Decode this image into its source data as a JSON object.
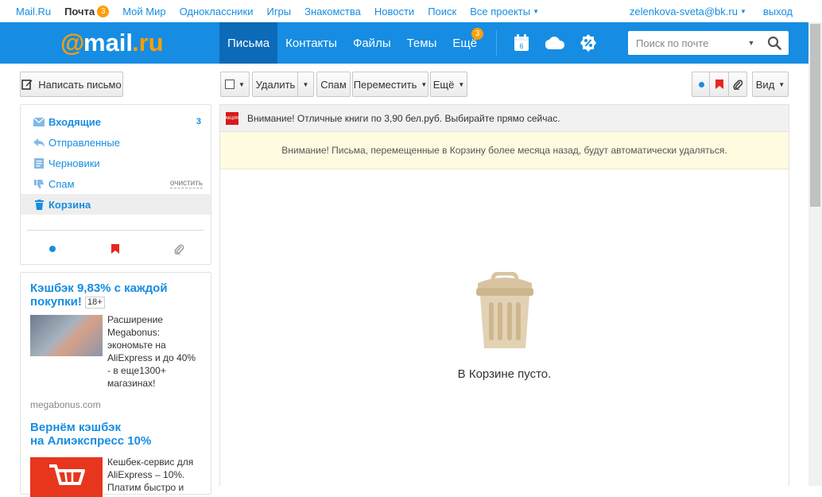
{
  "portal": {
    "items": [
      {
        "label": "Mail.Ru"
      },
      {
        "label": "Почта",
        "badge": "3"
      },
      {
        "label": "Мой Мир"
      },
      {
        "label": "Одноклассники"
      },
      {
        "label": "Игры"
      },
      {
        "label": "Знакомства"
      },
      {
        "label": "Новости"
      },
      {
        "label": "Поиск"
      },
      {
        "label": "Все проекты"
      }
    ],
    "user_email": "zelenkova-sveta@bk.ru",
    "logout": "выход"
  },
  "header": {
    "logo_main": "@mail",
    "logo_suffix": ".ru",
    "tabs": [
      {
        "label": "Письма"
      },
      {
        "label": "Контакты"
      },
      {
        "label": "Файлы"
      },
      {
        "label": "Темы"
      },
      {
        "label": "Ещё",
        "badge": "3"
      }
    ],
    "calendar_day": "6",
    "search_placeholder": "Поиск по почте"
  },
  "toolbar": {
    "compose": "Написать письмо",
    "delete": "Удалить",
    "spam": "Спам",
    "move": "Переместить",
    "more": "Ещё",
    "view": "Вид"
  },
  "folders": [
    {
      "label": "Входящие",
      "count": "3",
      "icon": "inbox-icon"
    },
    {
      "label": "Отправленные",
      "icon": "sent-icon"
    },
    {
      "label": "Черновики",
      "icon": "drafts-icon"
    },
    {
      "label": "Спам",
      "action": "очистить",
      "icon": "spam-icon"
    },
    {
      "label": "Корзина",
      "icon": "trash-icon"
    }
  ],
  "ads": [
    {
      "title": "Кэшбэк 9,83% с каждой покупки!",
      "age": "18+",
      "text": "Расширение Megabonus: экономьте на AliExpress и до 40% - в еще1300+ магазинах!",
      "source": "megabonus.com"
    },
    {
      "title_line1": "Вернём кэшбэк",
      "title_line2": "на Алиэкспресс 10%",
      "text": "Кешбек-сервис для AliExpress – 10%. Платим быстро и"
    }
  ],
  "promo": {
    "icon_text": "АКЦИЯ",
    "text": "Внимание! Отличные книги по 3,90 бел.руб. Выбирайте прямо сейчас."
  },
  "notice": "Внимание! Письма, перемещенные в Корзину более месяца назад, будут автоматически удаляться.",
  "empty_text": "В Корзине пусто.",
  "colors": {
    "brand_blue": "#168de2",
    "accent_orange": "#ff9e00",
    "notice_bg": "#fefbe1"
  }
}
